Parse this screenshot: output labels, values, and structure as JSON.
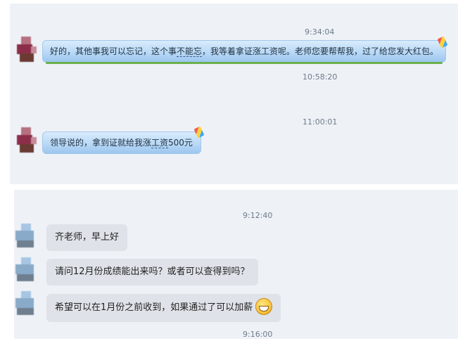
{
  "conversation_1": {
    "ts1": "9:34:04",
    "msg1": {
      "part_a": "好的，其他事我可以忘记，这个事",
      "part_b": "不能忘",
      "part_c": "，我等着拿证涨工资呢。老师您要帮帮我，过了给您发大红包。"
    },
    "ts2": "10:58:20",
    "ts3": "11:00:01",
    "msg2": {
      "part_a": "领导说的，拿到证就给我涨",
      "part_b": "工资",
      "part_c": "500元"
    }
  },
  "conversation_2": {
    "ts1": "9:12:40",
    "msg1": "齐老师，早上好",
    "msg2": "请问12月份成绩能出来吗？或者可以查得到吗？",
    "msg3": "希望可以在1月份之前收到，如果通过了可以加薪",
    "ts2": "9:16:00"
  },
  "icons": {
    "pin": "kite-decoration-icon",
    "emoji": "grinning-face-icon"
  }
}
